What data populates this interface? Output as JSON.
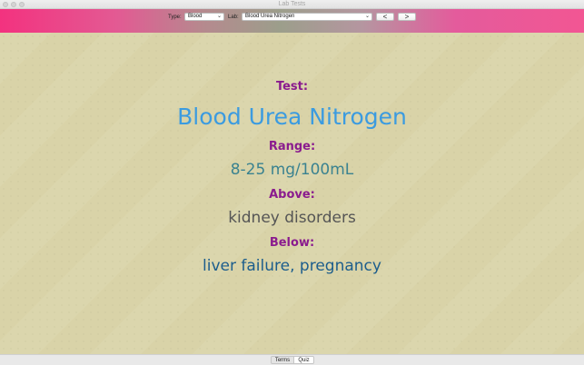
{
  "window": {
    "title": "Lab Tests"
  },
  "toolbar": {
    "type_label": "Type:",
    "type_value": "Blood",
    "lab_label": "Lab:",
    "lab_value": "Blood Urea Nitrogen",
    "prev_label": "<",
    "next_label": ">"
  },
  "main": {
    "test_heading": "Test:",
    "test_name": "Blood Urea Nitrogen",
    "range_heading": "Range:",
    "range_value": "8-25 mg/100mL",
    "above_heading": "Above:",
    "above_value": "kidney disorders",
    "below_heading": "Below:",
    "below_value": "liver failure, pregnancy"
  },
  "bottom": {
    "terms_label": "Terms",
    "quiz_label": "Quiz"
  },
  "colors": {
    "heading": "#8a1b8e",
    "test_name": "#3b9be0",
    "range_value": "#3a8290",
    "above_value": "#555555",
    "below_value": "#1c5d8c",
    "content_bg": "#d9d3a8"
  },
  "icons": {
    "type_caret": "chevron-updown-icon",
    "lab_caret": "chevron-updown-icon"
  }
}
